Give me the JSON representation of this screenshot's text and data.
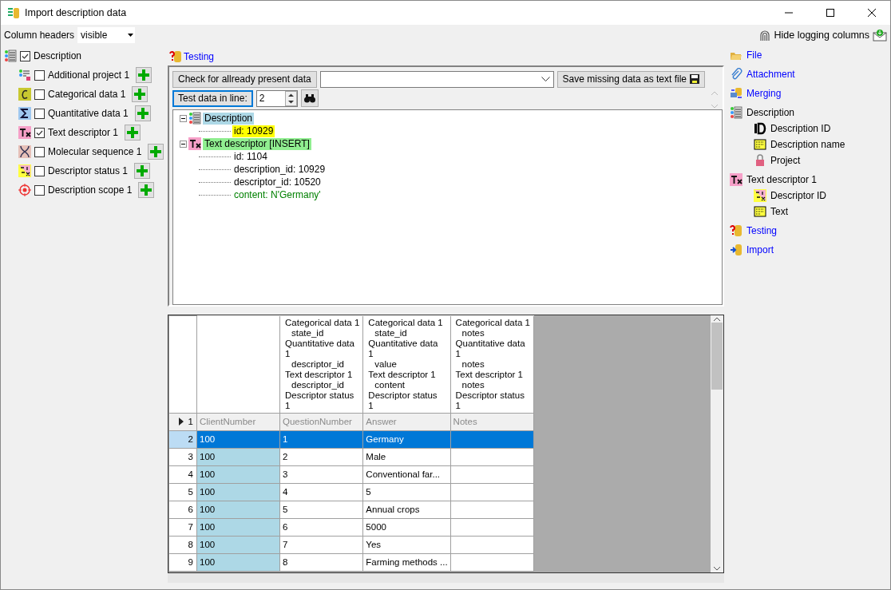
{
  "window": {
    "title": "Import description data"
  },
  "column_headers": {
    "label": "Column headers",
    "value": "visible"
  },
  "logging_button": {
    "label": "Hide logging columns"
  },
  "tables": {
    "label": "Description",
    "kind": "description",
    "checked": true,
    "children": [
      {
        "label": "Additional project 1",
        "kind": "project",
        "checked": false
      },
      {
        "label": "Categorical data 1",
        "kind": "categorical",
        "checked": false
      },
      {
        "label": "Quantitative data 1",
        "kind": "quantitative",
        "checked": false
      },
      {
        "label": "Text descriptor 1",
        "kind": "text",
        "checked": true
      },
      {
        "label": "Molecular sequence 1",
        "kind": "sequence",
        "checked": false
      },
      {
        "label": "Descriptor status 1",
        "kind": "status",
        "checked": false
      },
      {
        "label": "Description scope 1",
        "kind": "scope",
        "checked": false
      }
    ]
  },
  "testing": {
    "title": "Testing",
    "check_button": "Check for allready present data",
    "save_button": "Save missing data as text file",
    "test_button": "Test data in line:",
    "line": "2",
    "result_tree": [
      {
        "label": "Description",
        "kind": "description",
        "color": "#add8e6",
        "children": [
          {
            "label": "id: 10929",
            "kind": "field",
            "color": "#ffff00"
          }
        ]
      },
      {
        "label": "Text descriptor [INSERT]",
        "kind": "text",
        "color": "#90ee90",
        "children": [
          {
            "label": "id: 1104",
            "kind": "field"
          },
          {
            "label": "description_id: 10929",
            "kind": "field"
          },
          {
            "label": "descriptor_id: 10520",
            "kind": "field"
          },
          {
            "label": "content: N'Germany'",
            "kind": "content"
          }
        ]
      }
    ]
  },
  "grid": {
    "columns": [
      {
        "name": "ClientNumber",
        "highlighted": true
      },
      {
        "name": "QuestionNumber",
        "highlighted": false,
        "header": [
          {
            "text": "Categorical data 1",
            "sub": false
          },
          {
            "text": "state_id",
            "sub": true
          },
          {
            "text": "Quantitative data",
            "sub": false
          },
          {
            "text": "1",
            "sub": false
          },
          {
            "text": "descriptor_id",
            "sub": true
          },
          {
            "text": "Text descriptor 1",
            "sub": false
          },
          {
            "text": "descriptor_id",
            "sub": true
          },
          {
            "text": "Descriptor status",
            "sub": false
          },
          {
            "text": "1",
            "sub": false
          }
        ]
      },
      {
        "name": "Answer",
        "highlighted": false,
        "header": [
          {
            "text": "Categorical data 1",
            "sub": false
          },
          {
            "text": "state_id",
            "sub": true
          },
          {
            "text": "Quantitative data",
            "sub": false
          },
          {
            "text": "1",
            "sub": false
          },
          {
            "text": "value",
            "sub": true
          },
          {
            "text": "Text descriptor 1",
            "sub": false
          },
          {
            "text": "content",
            "sub": true
          },
          {
            "text": "Descriptor status",
            "sub": false
          },
          {
            "text": "1",
            "sub": false
          }
        ]
      },
      {
        "name": "Notes",
        "highlighted": false,
        "header": [
          {
            "text": "Categorical data 1",
            "sub": false
          },
          {
            "text": "notes",
            "sub": true
          },
          {
            "text": "Quantitative data",
            "sub": false
          },
          {
            "text": "1",
            "sub": false
          },
          {
            "text": "notes",
            "sub": true
          },
          {
            "text": "Text descriptor 1",
            "sub": false
          },
          {
            "text": "notes",
            "sub": true
          },
          {
            "text": "Descriptor status",
            "sub": false
          },
          {
            "text": "1",
            "sub": false
          }
        ]
      }
    ],
    "name_row": "1",
    "rows": [
      {
        "number": "2",
        "selected": true,
        "cells": [
          "100",
          "1",
          "Germany"
        ]
      },
      {
        "number": "3",
        "selected": false,
        "cells": [
          "100",
          "2",
          "Male"
        ]
      },
      {
        "number": "4",
        "selected": false,
        "cells": [
          "100",
          "3",
          "Conventional far..."
        ]
      },
      {
        "number": "5",
        "selected": false,
        "cells": [
          "100",
          "4",
          "5"
        ]
      },
      {
        "number": "6",
        "selected": false,
        "cells": [
          "100",
          "5",
          "Annual crops"
        ]
      },
      {
        "number": "7",
        "selected": false,
        "cells": [
          "100",
          "6",
          "5000"
        ]
      },
      {
        "number": "8",
        "selected": false,
        "cells": [
          "100",
          "7",
          "Yes"
        ]
      },
      {
        "number": "9",
        "selected": false,
        "cells": [
          "100",
          "8",
          "Farming methods ..."
        ]
      }
    ]
  },
  "steps": [
    {
      "label": "File",
      "kind": "file",
      "link": true
    },
    {
      "label": "Attachment",
      "kind": "attachment",
      "link": true
    },
    {
      "label": "Merging",
      "kind": "merging",
      "link": true
    },
    {
      "label": "Description",
      "kind": "description",
      "link": false,
      "children": [
        {
          "label": "Description ID",
          "kind": "id",
          "link": false
        },
        {
          "label": "Description name",
          "kind": "name",
          "link": false
        },
        {
          "label": "Project",
          "kind": "lock",
          "link": false
        }
      ]
    },
    {
      "label": "Text descriptor 1",
      "kind": "text",
      "link": false,
      "children": [
        {
          "label": "Descriptor ID",
          "kind": "status",
          "link": false
        },
        {
          "label": "Text",
          "kind": "name",
          "link": false
        }
      ]
    },
    {
      "label": "Testing",
      "kind": "testing",
      "link": true
    },
    {
      "label": "Import",
      "kind": "import",
      "link": true
    }
  ]
}
